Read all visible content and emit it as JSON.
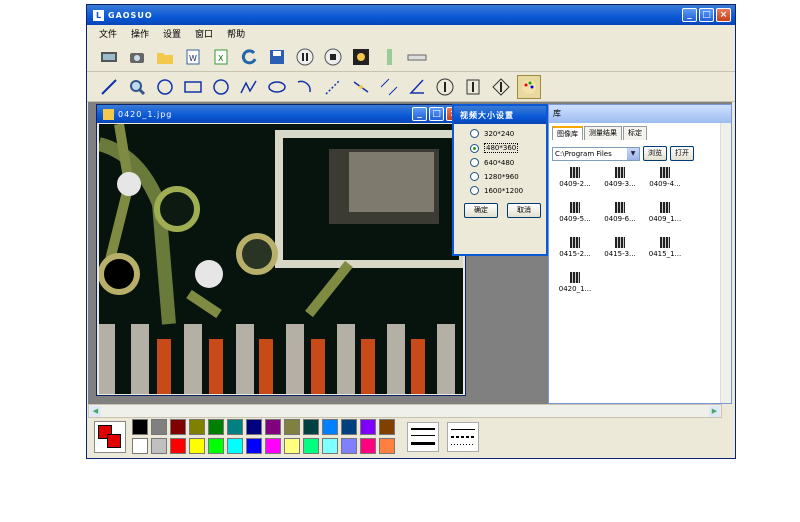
{
  "app": {
    "title": "GAOSUO",
    "icon_label": "L"
  },
  "menu": [
    "文件",
    "操作",
    "设置",
    "窗口",
    "帮助"
  ],
  "toolbar1": [
    "film-icon",
    "camera-icon",
    "folder-open-icon",
    "doc-w-icon",
    "doc-x-icon",
    "refresh-icon",
    "save-icon",
    "pause-icon",
    "stop-icon",
    "wrench-icon",
    "ruler-vertical-icon",
    "ruler-horizontal-icon"
  ],
  "toolbar2": [
    "line-tool-icon",
    "magnifier-icon",
    "circle-point-icon",
    "rectangle-icon",
    "circle-icon",
    "polyline-icon",
    "ellipse-icon",
    "arc-icon",
    "dotted-line-icon",
    "point-angle-icon",
    "parallel-lines-icon",
    "angle-icon",
    "vertical-dimension-icon",
    "horizontal-dimension-icon",
    "cross-dimension-icon",
    "palette-icon"
  ],
  "image_window": {
    "title": "0420_1.jpg"
  },
  "dialog": {
    "title": "视频大小设置",
    "options": [
      "320*240",
      "480*360",
      "640*480",
      "1280*960",
      "1600*1200"
    ],
    "selected": "480*360",
    "ok": "确定",
    "cancel": "取消"
  },
  "panel": {
    "title": "库",
    "tabs": [
      "图像库",
      "测量结果",
      "标定"
    ],
    "active_tab": "图像库",
    "path": "C:\\Program Files",
    "browse": "浏览",
    "open": "打开",
    "thumbnails": [
      "0409-2...",
      "0409-3...",
      "0409-4...",
      "0409-5...",
      "0409-6...",
      "0409_1...",
      "0415-2...",
      "0415-3...",
      "0415_1...",
      "0420_1..."
    ]
  },
  "palette": {
    "current_color": "#e00000",
    "colors": [
      "#000000",
      "#808080",
      "#800000",
      "#808000",
      "#008000",
      "#008080",
      "#000080",
      "#800080",
      "#808040",
      "#004040",
      "#0080ff",
      "#004080",
      "#8000ff",
      "#804000",
      "#ffffff",
      "#c0c0c0",
      "#ff0000",
      "#ffff00",
      "#00ff00",
      "#00ffff",
      "#0000ff",
      "#ff00ff",
      "#ffff80",
      "#00ff80",
      "#80ffff",
      "#8080ff",
      "#ff0080",
      "#ff8040"
    ]
  }
}
